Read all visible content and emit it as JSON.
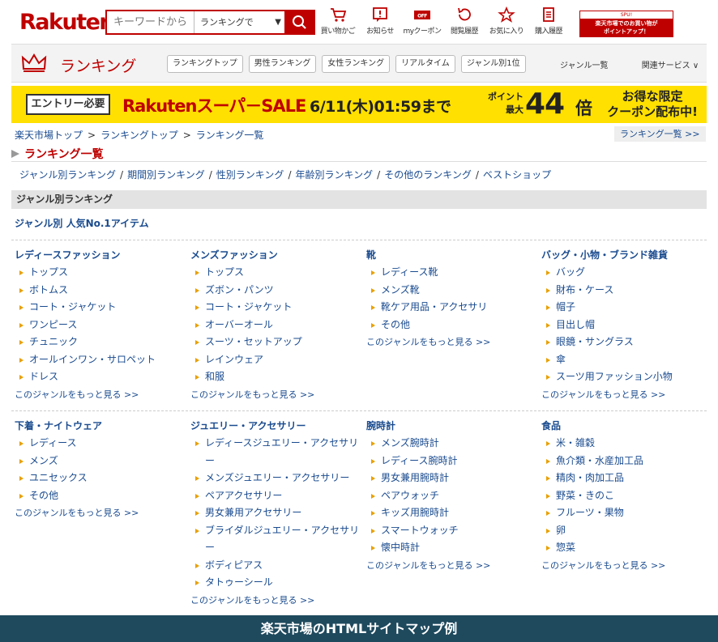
{
  "header": {
    "logo": "Rakuten",
    "search_placeholder": "キーワードから",
    "search_select": "ランキングで",
    "icons": [
      {
        "name": "cart-icon",
        "label": "買い物かご"
      },
      {
        "name": "notification-icon",
        "label": "お知らせ"
      },
      {
        "name": "coupon-icon",
        "label": "myクーポン"
      },
      {
        "name": "history-icon",
        "label": "閲覧履歴"
      },
      {
        "name": "star-icon",
        "label": "お気に入り"
      },
      {
        "name": "receipt-icon",
        "label": "購入履歴"
      }
    ],
    "sput_top": "SPU!",
    "sput_bottom_1": "楽天市場でのお買い物が",
    "sput_bottom_2": "ポイントアップ！"
  },
  "ranking_nav": {
    "title": "ランキング",
    "tabs": [
      "ランキングトップ",
      "男性ランキング",
      "女性ランキング",
      "リアルタイム",
      "ジャンル別1位"
    ],
    "genre_list": "ジャンル一覧",
    "related": "関連サービス ∨"
  },
  "banner": {
    "entry": "エントリー必要",
    "sale": "Rakutenスーパ－SALE",
    "date": "6/11(木)01:59まで",
    "point_1": "ポイント",
    "point_2": "最大",
    "multiplier": "44",
    "bai": "倍",
    "coupon_1": "お得な限定",
    "coupon_2": "クーポン配布中!"
  },
  "breadcrumb": [
    "楽天市場トップ",
    "ランキングトップ",
    "ランキング一覧"
  ],
  "breadcrumb_button": "ランキング一覧 >>",
  "page_title": "ランキング一覧",
  "category_links": [
    "ジャンル別ランキング",
    "期間別ランキング",
    "性別ランキング",
    "年齢別ランキング",
    "その他のランキング",
    "ベストショップ"
  ],
  "section_title": "ジャンル別ランキング",
  "subhead": "ジャンル別 人気No.1アイテム",
  "more_label": "このジャンルをもっと見る >>",
  "genres_row1": [
    {
      "title": "レディースファッション",
      "items": [
        "トップス",
        "ボトムス",
        "コート・ジャケット",
        "ワンピース",
        "チュニック",
        "オールインワン・サロペット",
        "ドレス"
      ]
    },
    {
      "title": "メンズファッション",
      "items": [
        "トップス",
        "ズボン・パンツ",
        "コート・ジャケット",
        "オーバーオール",
        "スーツ・セットアップ",
        "レインウェア",
        "和服"
      ]
    },
    {
      "title": "靴",
      "items": [
        "レディース靴",
        "メンズ靴",
        "靴ケア用品・アクセサリ",
        "その他"
      ]
    },
    {
      "title": "バッグ・小物・ブランド雑貨",
      "items": [
        "バッグ",
        "財布・ケース",
        "帽子",
        "目出し帽",
        "眼鏡・サングラス",
        "傘",
        "スーツ用ファッション小物"
      ]
    }
  ],
  "genres_row2": [
    {
      "title": "下着・ナイトウェア",
      "items": [
        "レディース",
        "メンズ",
        "ユニセックス",
        "その他"
      ]
    },
    {
      "title": "ジュエリー・アクセサリー",
      "items": [
        "レディースジュエリー・アクセサリー",
        "メンズジュエリー・アクセサリー",
        "ペアアクセサリー",
        "男女兼用アクセサリー",
        "ブライダルジュエリー・アクセサリー",
        "ボディピアス",
        "タトゥーシール"
      ]
    },
    {
      "title": "腕時計",
      "items": [
        "メンズ腕時計",
        "レディース腕時計",
        "男女兼用腕時計",
        "ペアウォッチ",
        "キッズ用腕時計",
        "スマートウォッチ",
        "懐中時計"
      ]
    },
    {
      "title": "食品",
      "items": [
        "米・雑穀",
        "魚介類・水産加工品",
        "精肉・肉加工品",
        "野菜・きのこ",
        "フルーツ・果物",
        "卵",
        "惣菜"
      ]
    }
  ],
  "footer_caption": "楽天市場のHTMLサイトマップ例",
  "colors": {
    "brand_red": "#bf0000",
    "link_blue": "#1a4b8f",
    "banner_yellow": "#ffe000",
    "footer_teal": "#1f4a5e"
  }
}
